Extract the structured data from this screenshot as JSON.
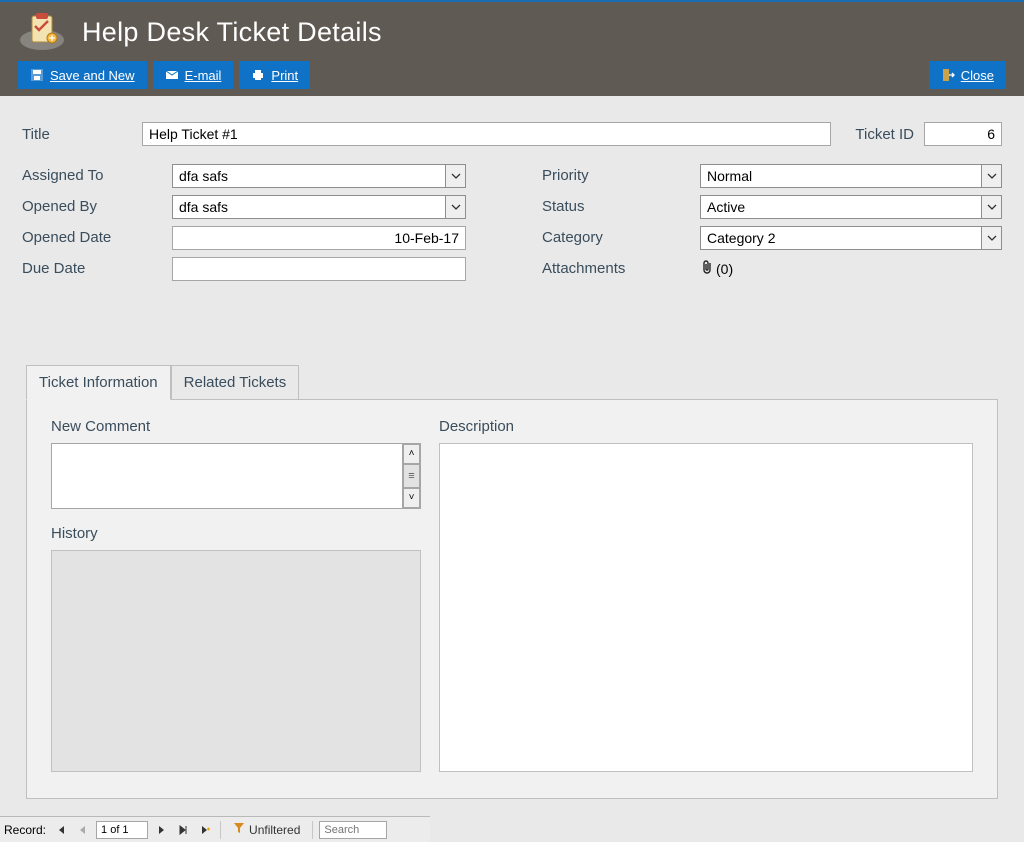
{
  "header": {
    "title": "Help Desk Ticket Details"
  },
  "toolbar": {
    "save_new": "Save and New",
    "email": "E-mail",
    "print": "Print",
    "close": "Close"
  },
  "form": {
    "title_label": "Title",
    "title_value": "Help Ticket #1",
    "ticket_id_label": "Ticket ID",
    "ticket_id_value": "6",
    "assigned_to_label": "Assigned To",
    "assigned_to_value": "dfa safs",
    "opened_by_label": "Opened By",
    "opened_by_value": "dfa safs",
    "opened_date_label": "Opened Date",
    "opened_date_value": "10-Feb-17",
    "due_date_label": "Due Date",
    "due_date_value": "",
    "priority_label": "Priority",
    "priority_value": "Normal",
    "status_label": "Status",
    "status_value": "Active",
    "category_label": "Category",
    "category_value": "Category 2",
    "attachments_label": "Attachments",
    "attachments_count": "(0)"
  },
  "tabs": {
    "ticket_info": "Ticket Information",
    "related": "Related Tickets"
  },
  "panel": {
    "new_comment": "New Comment",
    "history": "History",
    "description": "Description"
  },
  "recordbar": {
    "label": "Record:",
    "position": "1 of 1",
    "filter": "Unfiltered",
    "search_placeholder": "Search"
  }
}
